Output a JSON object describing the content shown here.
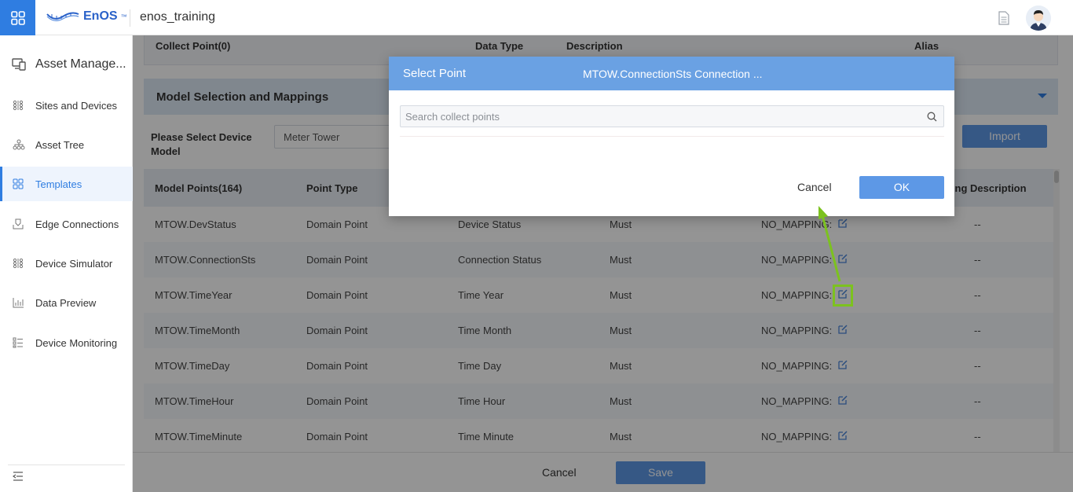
{
  "topbar": {
    "logo_text": "EnOS",
    "logo_tm": "™",
    "org_name": "enos_training"
  },
  "sidebar": {
    "header": "Asset Manage...",
    "items": [
      {
        "label": "Sites and Devices",
        "icon": "grid-dots-icon"
      },
      {
        "label": "Asset Tree",
        "icon": "tree-icon"
      },
      {
        "label": "Templates",
        "icon": "template-icon",
        "active": true
      },
      {
        "label": "Edge Connections",
        "icon": "edge-icon"
      },
      {
        "label": "Device Simulator",
        "icon": "simulator-icon"
      },
      {
        "label": "Data Preview",
        "icon": "chart-icon"
      },
      {
        "label": "Device Monitoring",
        "icon": "list-icon"
      }
    ]
  },
  "collect_points": {
    "col1": "Collect Point(0)",
    "col2": "Data Type",
    "col3": "Description",
    "col4": "Alias"
  },
  "model_section": {
    "title": "Model Selection and Mappings",
    "select_label": "Please Select Device Model",
    "selected_model": "Meter Tower",
    "import_label": "Import"
  },
  "table": {
    "headers": [
      "Model Points(164)",
      "Point Type",
      "",
      "",
      "",
      "ping Description"
    ],
    "rows": [
      [
        "MTOW.DevStatus",
        "Domain Point",
        "Device Status",
        "Must",
        "NO_MAPPING:",
        "--"
      ],
      [
        "MTOW.ConnectionSts",
        "Domain Point",
        "Connection Status",
        "Must",
        "NO_MAPPING:",
        "--"
      ],
      [
        "MTOW.TimeYear",
        "Domain Point",
        "Time Year",
        "Must",
        "NO_MAPPING:",
        "--"
      ],
      [
        "MTOW.TimeMonth",
        "Domain Point",
        "Time Month",
        "Must",
        "NO_MAPPING:",
        "--"
      ],
      [
        "MTOW.TimeDay",
        "Domain Point",
        "Time Day",
        "Must",
        "NO_MAPPING:",
        "--"
      ],
      [
        "MTOW.TimeHour",
        "Domain Point",
        "Time Hour",
        "Must",
        "NO_MAPPING:",
        "--"
      ],
      [
        "MTOW.TimeMinute",
        "Domain Point",
        "Time Minute",
        "Must",
        "NO_MAPPING:",
        "--"
      ]
    ]
  },
  "footer": {
    "cancel": "Cancel",
    "save": "Save"
  },
  "modal": {
    "title": "Select Point",
    "subtitle": "MTOW.ConnectionSts  Connection ...",
    "search_placeholder": "Search collect points",
    "cancel": "Cancel",
    "ok": "OK"
  },
  "colors": {
    "brand": "#2f7de1",
    "modal_header": "#6aa1e3",
    "primary_button": "#5d98e6",
    "annotation": "#7cc21f"
  }
}
